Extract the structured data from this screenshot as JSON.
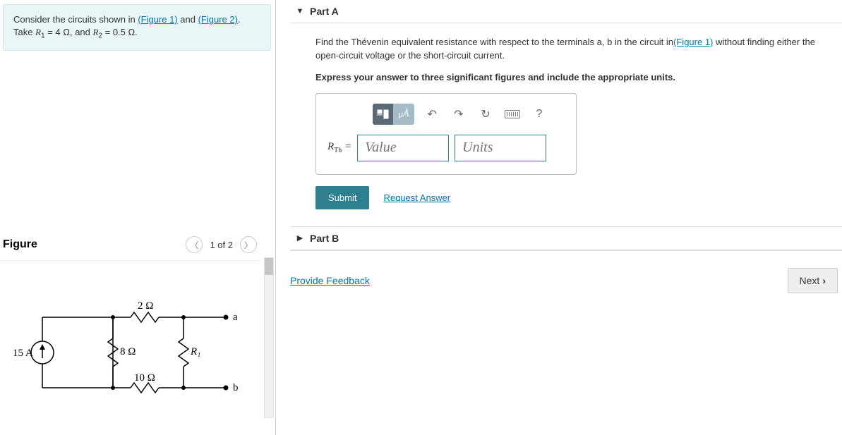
{
  "problem": {
    "text_before": "Consider the circuits shown in ",
    "link1": "(Figure 1)",
    "mid": " and ",
    "link2": "(Figure 2)",
    "after": ".",
    "line2_pre": "Take ",
    "r1_var": "R",
    "r1_sub": "1",
    "r1_eq": " = 4 Ω, and ",
    "r2_var": "R",
    "r2_sub": "2",
    "r2_eq": " = 0.5 Ω."
  },
  "figure": {
    "title": "Figure",
    "pager_text": "1 of 2",
    "source_label": "15 A",
    "r_top": "2 Ω",
    "r_mid": "8 Ω",
    "r_bottom": "10 Ω",
    "r1_label": "R₁",
    "term_a": "a",
    "term_b": "b"
  },
  "partA": {
    "label": "Part A",
    "text1a": "Find the Thévenin equivalent resistance with respect to the terminals a, b in the circuit in",
    "text1_link": "(Figure 1)",
    "text1b": " without finding either the open-circuit voltage or the short-circuit current.",
    "text2": "Express your answer to three significant figures and include the appropriate units.",
    "var_label": "R",
    "var_sub": "Th",
    "eq": " = ",
    "value_ph": "Value",
    "units_ph": "Units",
    "mu_label": "μA",
    "submit": "Submit",
    "request": "Request Answer"
  },
  "partB": {
    "label": "Part B"
  },
  "footer": {
    "feedback": "Provide Feedback",
    "next": "Next"
  }
}
